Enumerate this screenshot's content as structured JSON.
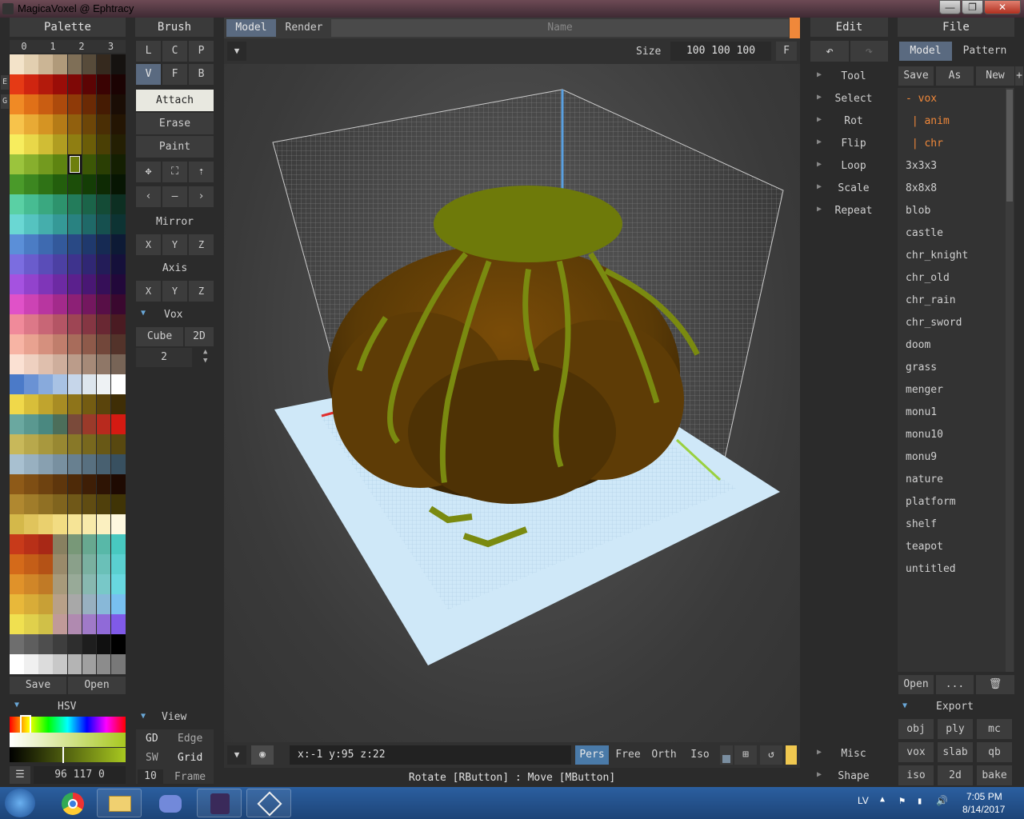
{
  "window": {
    "title": "MagicaVoxel @ Ephtracy",
    "min": "—",
    "max": "❐",
    "close": "✕"
  },
  "palette": {
    "header": "Palette",
    "tabs": [
      "0",
      "1",
      "2",
      "3"
    ],
    "side_tabs": [
      "E",
      "G"
    ],
    "save": "Save",
    "open": "Open",
    "hsv_label": "HSV",
    "color_value": "96 117 0",
    "rows": [
      [
        "#f3e3c9",
        "#e2cfb0",
        "#cbb595",
        "#b09a7a",
        "#7f6f57",
        "#574b3a",
        "#35291e",
        "#151210"
      ],
      [
        "#e53a15",
        "#cf2510",
        "#b31a0c",
        "#9a0d08",
        "#7f0806",
        "#5c0404",
        "#3a0303",
        "#1b0303"
      ],
      [
        "#f08a25",
        "#e07018",
        "#c95d12",
        "#ad4a0c",
        "#8f3a08",
        "#6b2a05",
        "#451b03",
        "#1a0d05"
      ],
      [
        "#f7c34b",
        "#e8aa35",
        "#d59423",
        "#b57b17",
        "#91600e",
        "#6d4608",
        "#4a2e05",
        "#241503"
      ],
      [
        "#f7ed5e",
        "#e8d749",
        "#d0bd35",
        "#b09d21",
        "#8f7e12",
        "#6b5d08",
        "#4a3f05",
        "#241f03"
      ],
      [
        "#9bc43d",
        "#87af2d",
        "#739a1f",
        "#5e8411",
        "#6d7f0c",
        "#3c5706",
        "#2a3e04",
        "#141f02"
      ],
      [
        "#4a9a2a",
        "#3c8620",
        "#2f7216",
        "#235e0d",
        "#1c4e09",
        "#143d06",
        "#0e2a04",
        "#071503"
      ],
      [
        "#5ad0a4",
        "#47bc92",
        "#3aa880",
        "#2d936d",
        "#237c5b",
        "#1b6449",
        "#144b36",
        "#0d2f22"
      ],
      [
        "#6ad7d3",
        "#55c3c0",
        "#45aeac",
        "#359997",
        "#298281",
        "#1f6968",
        "#16504f",
        "#0d3333"
      ],
      [
        "#5b8fd8",
        "#4b7cc4",
        "#3e6ab0",
        "#33599b",
        "#294985",
        "#1f396d",
        "#162a53",
        "#0d1a35"
      ],
      [
        "#7b6de0",
        "#6a5ccc",
        "#5a4db8",
        "#4c40a3",
        "#3e338d",
        "#302774",
        "#231c58",
        "#15103a"
      ],
      [
        "#a552e0",
        "#9243cc",
        "#7f36b8",
        "#6d2aa3",
        "#5b208d",
        "#491774",
        "#360f58",
        "#22083a"
      ],
      [
        "#e052c8",
        "#cc43b4",
        "#b836a0",
        "#a32a8b",
        "#8d2076",
        "#74175f",
        "#580f47",
        "#3a082f"
      ],
      [
        "#f08a9a",
        "#dc7888",
        "#c86676",
        "#b45565",
        "#9e4554",
        "#853643",
        "#692833",
        "#4a1b22"
      ],
      [
        "#f7b4a4",
        "#e8a290",
        "#d5907e",
        "#c07e6c",
        "#a86c5b",
        "#8e5a4a",
        "#72473a",
        "#53332a"
      ],
      [
        "#fbe1d3",
        "#eed0c0",
        "#dfbfad",
        "#ceae9c",
        "#bb9c8a",
        "#a68a78",
        "#8f7767",
        "#776456"
      ],
      [
        "#4b7ac8",
        "#6a92d4",
        "#88aadc",
        "#a8c2e4",
        "#c6d6ea",
        "#dde6ee",
        "#eef2f4",
        "#ffffff"
      ],
      [
        "#f0d84a",
        "#d8be3a",
        "#c0a42e",
        "#a88c24",
        "#8e741a",
        "#745c12",
        "#5a440c",
        "#3f2e06"
      ],
      [
        "#6aa8a0",
        "#5a9890",
        "#4a8880",
        "#4c6e5a",
        "#7a4a3a",
        "#9a3a2a",
        "#b82a1e",
        "#d41a12"
      ],
      [
        "#c8b85a",
        "#b8a84c",
        "#a8983e",
        "#988832",
        "#887828",
        "#78681e",
        "#685816",
        "#584810"
      ],
      [
        "#a8c0d0",
        "#98b0c0",
        "#88a0b0",
        "#7890a0",
        "#688090",
        "#587080",
        "#486070",
        "#385060"
      ],
      [
        "#8e5a18",
        "#7e4e14",
        "#6e4210",
        "#5e360c",
        "#4e2a08",
        "#3e1e06",
        "#2e1404",
        "#1e0a02"
      ],
      [
        "#b08830",
        "#a07c2a",
        "#907024",
        "#80641e",
        "#705818",
        "#604c12",
        "#50400c",
        "#403406"
      ],
      [
        "#d4b84a",
        "#e0c45c",
        "#ead06e",
        "#f2dc82",
        "#f6e496",
        "#f8eaaa",
        "#fbf0c0",
        "#fef8e0"
      ],
      [
        "#c83a1a",
        "#b83018",
        "#a82816",
        "#888060",
        "#789878",
        "#68a890",
        "#58b8a8",
        "#48c8c0"
      ],
      [
        "#d46a1a",
        "#c45e18",
        "#b45216",
        "#9a8a6a",
        "#8aa08a",
        "#7ab0a0",
        "#6ac0b8",
        "#5ad0d0"
      ],
      [
        "#e0922a",
        "#d08628",
        "#c07a26",
        "#a89a7a",
        "#98aa98",
        "#88b8b0",
        "#78c8c8",
        "#68d8e0"
      ],
      [
        "#e8b83a",
        "#d8ac38",
        "#c8a036",
        "#b8a088",
        "#a8a8a8",
        "#98b0c0",
        "#88b8d8",
        "#78c0f0"
      ],
      [
        "#f0e050",
        "#e0d04c",
        "#d0c048",
        "#c09a98",
        "#b08ab0",
        "#a07ac8",
        "#906ad8",
        "#805ae8"
      ],
      [
        "#6e6e6e",
        "#5e5e5e",
        "#4e4e4e",
        "#3e3e3e",
        "#2e2e2e",
        "#1e1e1e",
        "#101010",
        "#000000"
      ],
      [
        "#ffffff",
        "#f0f0f0",
        "#dcdcdc",
        "#c8c8c8",
        "#b4b4b4",
        "#a0a0a0",
        "#8c8c8c",
        "#787878"
      ]
    ]
  },
  "brush": {
    "header": "Brush",
    "modes1": [
      "L",
      "C",
      "P"
    ],
    "modes2": [
      "V",
      "F",
      "B"
    ],
    "actions": [
      "Attach",
      "Erase",
      "Paint"
    ],
    "mirror_label": "Mirror",
    "axis_label": "Axis",
    "xyz": [
      "X",
      "Y",
      "Z"
    ],
    "vox_label": "Vox",
    "cube": "Cube",
    "two_d": "2D",
    "count": "2"
  },
  "view": {
    "label": "View",
    "gd": "GD",
    "edge": "Edge",
    "sw": "SW",
    "grid": "Grid",
    "frame_num": "10",
    "frame": "Frame"
  },
  "viewport": {
    "tab_model": "Model",
    "tab_render": "Render",
    "name_placeholder": "Name",
    "size_label": "Size",
    "size_value": "100 100 100",
    "f_btn": "F",
    "coords": "x:-1   y:95   z:22",
    "modes": [
      "Pers",
      "Free",
      "Orth",
      "Iso"
    ],
    "status": "Rotate [RButton] : Move [MButton]",
    "accent": "#f0883a"
  },
  "edit": {
    "header": "Edit",
    "items": [
      "Tool",
      "Select",
      "Rot",
      "Flip",
      "Loop",
      "Scale",
      "Repeat"
    ],
    "bottom": [
      "Misc",
      "Shape"
    ]
  },
  "file": {
    "header": "File",
    "tabs": [
      "Model",
      "Pattern"
    ],
    "actions": [
      "Save",
      "As",
      "New",
      "+"
    ],
    "items": [
      "- vox",
      " | anim",
      " | chr",
      "3x3x3",
      "8x8x8",
      "blob",
      "castle",
      "chr_knight",
      "chr_old",
      "chr_rain",
      "chr_sword",
      "doom",
      "grass",
      "menger",
      "monu1",
      "monu10",
      "monu9",
      "nature",
      "platform",
      "shelf",
      "teapot",
      "untitled"
    ],
    "open": "Open",
    "more": "...",
    "export_label": "Export",
    "export": [
      "obj",
      "ply",
      "mc",
      "vox",
      "slab",
      "qb",
      "iso",
      "2d",
      "bake"
    ]
  },
  "taskbar": {
    "lang": "LV",
    "time": "7:05 PM",
    "date": "8/14/2017"
  }
}
